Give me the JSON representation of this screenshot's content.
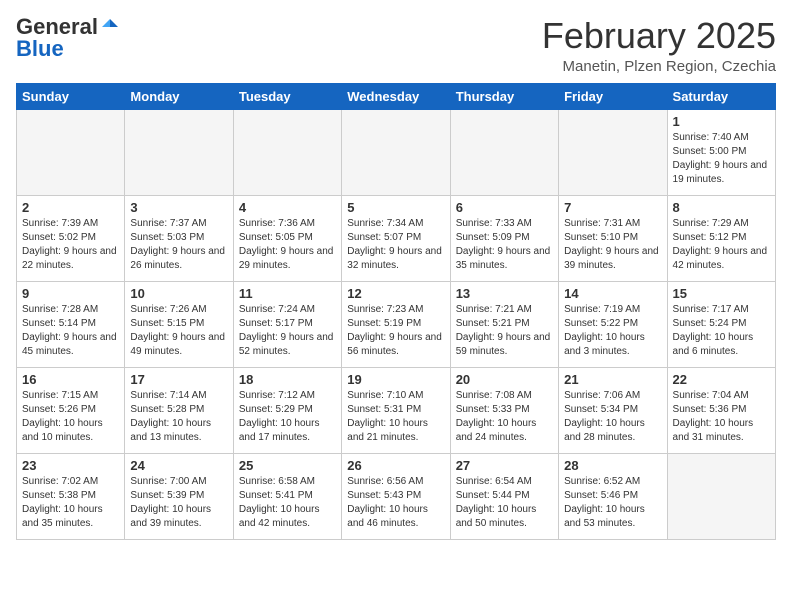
{
  "header": {
    "logo_general": "General",
    "logo_blue": "Blue",
    "month": "February 2025",
    "location": "Manetin, Plzen Region, Czechia"
  },
  "weekdays": [
    "Sunday",
    "Monday",
    "Tuesday",
    "Wednesday",
    "Thursday",
    "Friday",
    "Saturday"
  ],
  "weeks": [
    [
      {
        "day": "",
        "info": ""
      },
      {
        "day": "",
        "info": ""
      },
      {
        "day": "",
        "info": ""
      },
      {
        "day": "",
        "info": ""
      },
      {
        "day": "",
        "info": ""
      },
      {
        "day": "",
        "info": ""
      },
      {
        "day": "1",
        "info": "Sunrise: 7:40 AM\nSunset: 5:00 PM\nDaylight: 9 hours\nand 19 minutes."
      }
    ],
    [
      {
        "day": "2",
        "info": "Sunrise: 7:39 AM\nSunset: 5:02 PM\nDaylight: 9 hours\nand 22 minutes."
      },
      {
        "day": "3",
        "info": "Sunrise: 7:37 AM\nSunset: 5:03 PM\nDaylight: 9 hours\nand 26 minutes."
      },
      {
        "day": "4",
        "info": "Sunrise: 7:36 AM\nSunset: 5:05 PM\nDaylight: 9 hours\nand 29 minutes."
      },
      {
        "day": "5",
        "info": "Sunrise: 7:34 AM\nSunset: 5:07 PM\nDaylight: 9 hours\nand 32 minutes."
      },
      {
        "day": "6",
        "info": "Sunrise: 7:33 AM\nSunset: 5:09 PM\nDaylight: 9 hours\nand 35 minutes."
      },
      {
        "day": "7",
        "info": "Sunrise: 7:31 AM\nSunset: 5:10 PM\nDaylight: 9 hours\nand 39 minutes."
      },
      {
        "day": "8",
        "info": "Sunrise: 7:29 AM\nSunset: 5:12 PM\nDaylight: 9 hours\nand 42 minutes."
      }
    ],
    [
      {
        "day": "9",
        "info": "Sunrise: 7:28 AM\nSunset: 5:14 PM\nDaylight: 9 hours\nand 45 minutes."
      },
      {
        "day": "10",
        "info": "Sunrise: 7:26 AM\nSunset: 5:15 PM\nDaylight: 9 hours\nand 49 minutes."
      },
      {
        "day": "11",
        "info": "Sunrise: 7:24 AM\nSunset: 5:17 PM\nDaylight: 9 hours\nand 52 minutes."
      },
      {
        "day": "12",
        "info": "Sunrise: 7:23 AM\nSunset: 5:19 PM\nDaylight: 9 hours\nand 56 minutes."
      },
      {
        "day": "13",
        "info": "Sunrise: 7:21 AM\nSunset: 5:21 PM\nDaylight: 9 hours\nand 59 minutes."
      },
      {
        "day": "14",
        "info": "Sunrise: 7:19 AM\nSunset: 5:22 PM\nDaylight: 10 hours\nand 3 minutes."
      },
      {
        "day": "15",
        "info": "Sunrise: 7:17 AM\nSunset: 5:24 PM\nDaylight: 10 hours\nand 6 minutes."
      }
    ],
    [
      {
        "day": "16",
        "info": "Sunrise: 7:15 AM\nSunset: 5:26 PM\nDaylight: 10 hours\nand 10 minutes."
      },
      {
        "day": "17",
        "info": "Sunrise: 7:14 AM\nSunset: 5:28 PM\nDaylight: 10 hours\nand 13 minutes."
      },
      {
        "day": "18",
        "info": "Sunrise: 7:12 AM\nSunset: 5:29 PM\nDaylight: 10 hours\nand 17 minutes."
      },
      {
        "day": "19",
        "info": "Sunrise: 7:10 AM\nSunset: 5:31 PM\nDaylight: 10 hours\nand 21 minutes."
      },
      {
        "day": "20",
        "info": "Sunrise: 7:08 AM\nSunset: 5:33 PM\nDaylight: 10 hours\nand 24 minutes."
      },
      {
        "day": "21",
        "info": "Sunrise: 7:06 AM\nSunset: 5:34 PM\nDaylight: 10 hours\nand 28 minutes."
      },
      {
        "day": "22",
        "info": "Sunrise: 7:04 AM\nSunset: 5:36 PM\nDaylight: 10 hours\nand 31 minutes."
      }
    ],
    [
      {
        "day": "23",
        "info": "Sunrise: 7:02 AM\nSunset: 5:38 PM\nDaylight: 10 hours\nand 35 minutes."
      },
      {
        "day": "24",
        "info": "Sunrise: 7:00 AM\nSunset: 5:39 PM\nDaylight: 10 hours\nand 39 minutes."
      },
      {
        "day": "25",
        "info": "Sunrise: 6:58 AM\nSunset: 5:41 PM\nDaylight: 10 hours\nand 42 minutes."
      },
      {
        "day": "26",
        "info": "Sunrise: 6:56 AM\nSunset: 5:43 PM\nDaylight: 10 hours\nand 46 minutes."
      },
      {
        "day": "27",
        "info": "Sunrise: 6:54 AM\nSunset: 5:44 PM\nDaylight: 10 hours\nand 50 minutes."
      },
      {
        "day": "28",
        "info": "Sunrise: 6:52 AM\nSunset: 5:46 PM\nDaylight: 10 hours\nand 53 minutes."
      },
      {
        "day": "",
        "info": ""
      }
    ]
  ]
}
